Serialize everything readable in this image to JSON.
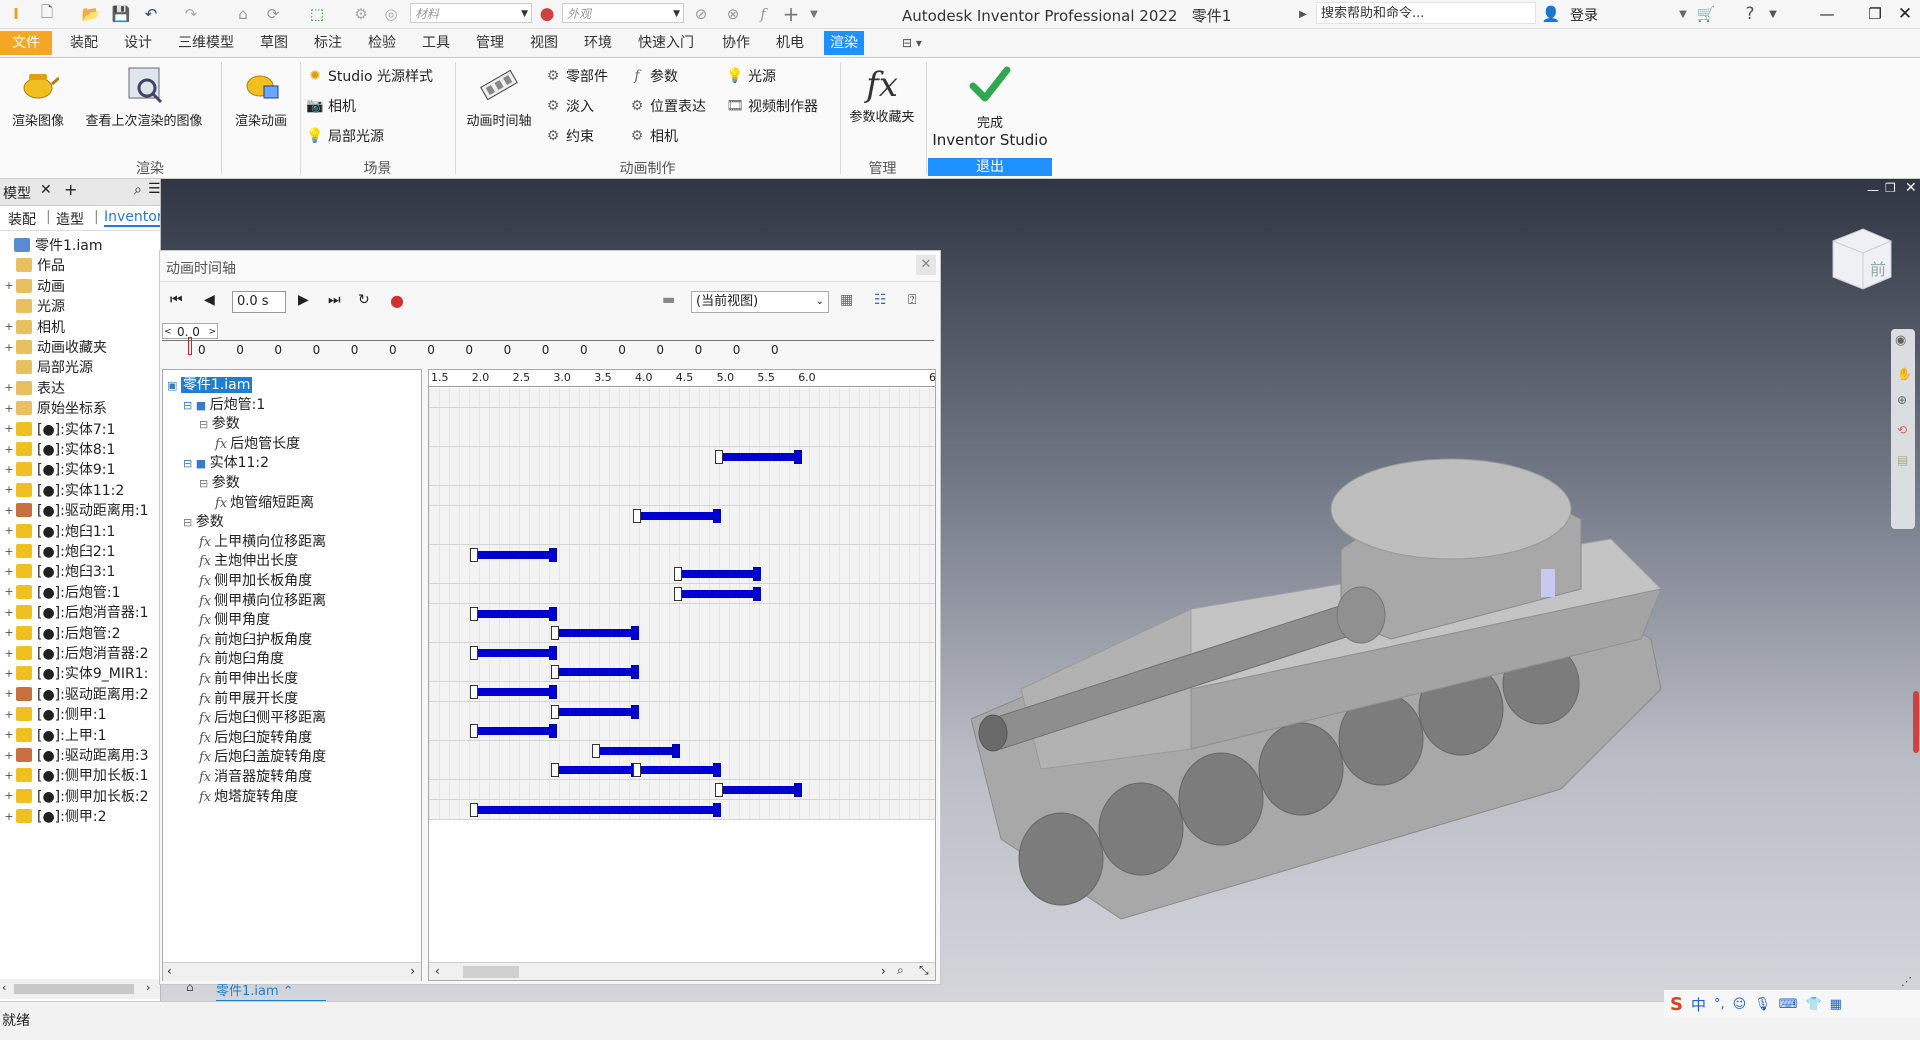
{
  "titlebar": {
    "material_placeholder": "材料",
    "appearance_placeholder": "外观",
    "app_title": "Autodesk Inventor Professional 2022",
    "doc_title": "零件1",
    "search_placeholder": "搜索帮助和命令...",
    "login": "登录"
  },
  "menu": {
    "tabs": [
      "文件",
      "装配",
      "设计",
      "三维模型",
      "草图",
      "标注",
      "检验",
      "工具",
      "管理",
      "视图",
      "环境",
      "快速入门",
      "协作",
      "机电",
      "渲染"
    ],
    "active": "渲染"
  },
  "ribbon": {
    "render": {
      "btn1": "渲染图像",
      "btn2": "查看上次渲染的图像",
      "btn3": "渲染动画",
      "label": "渲染"
    },
    "scene": {
      "studio": "Studio 光源样式",
      "camera": "相机",
      "local_light": "局部光源",
      "label": "场景"
    },
    "animation": {
      "timeline": "动画时间轴",
      "component": "零部件",
      "fade": "淡入",
      "constraint": "约束",
      "param": "参数",
      "position": "位置表达",
      "camera": "相机",
      "light": "光源",
      "video": "视频制作器",
      "label": "动画制作"
    },
    "manage": {
      "fav": "参数收藏夹",
      "label": "管理"
    },
    "exit": {
      "finish": "完成",
      "studio": "Inventor Studio",
      "label": "退出"
    }
  },
  "left_panel": {
    "tab": "模型",
    "subtabs": [
      "装配",
      "造型",
      "Inventor S"
    ],
    "tree": [
      {
        "label": "零件1.iam",
        "exp": ""
      },
      {
        "label": "作品",
        "exp": ""
      },
      {
        "label": "动画",
        "exp": "+"
      },
      {
        "label": "光源",
        "exp": ""
      },
      {
        "label": "相机",
        "exp": "+"
      },
      {
        "label": "动画收藏夹",
        "exp": "+"
      },
      {
        "label": "局部光源",
        "exp": ""
      },
      {
        "label": "表达",
        "exp": "+"
      },
      {
        "label": "原始坐标系",
        "exp": "+"
      },
      {
        "label": "[●]:实体7:1",
        "exp": "+"
      },
      {
        "label": "[●]:实体8:1",
        "exp": "+"
      },
      {
        "label": "[●]:实体9:1",
        "exp": "+"
      },
      {
        "label": "[●]:实体11:2",
        "exp": "+"
      },
      {
        "label": "[●]:驱动距离用:1",
        "exp": "+"
      },
      {
        "label": "[●]:炮臼1:1",
        "exp": "+"
      },
      {
        "label": "[●]:炮臼2:1",
        "exp": "+"
      },
      {
        "label": "[●]:炮臼3:1",
        "exp": "+"
      },
      {
        "label": "[●]:后炮管:1",
        "exp": "+"
      },
      {
        "label": "[●]:后炮消音器:1",
        "exp": "+"
      },
      {
        "label": "[●]:后炮管:2",
        "exp": "+"
      },
      {
        "label": "[●]:后炮消音器:2",
        "exp": "+"
      },
      {
        "label": "[●]:实体9_MIR1:",
        "exp": "+"
      },
      {
        "label": "[●]:驱动距离用:2",
        "exp": "+"
      },
      {
        "label": "[●]:侧甲:1",
        "exp": "+"
      },
      {
        "label": "[●]:上甲:1",
        "exp": "+"
      },
      {
        "label": "[●]:驱动距离用:3",
        "exp": "+"
      },
      {
        "label": "[●]:侧甲加长板:1",
        "exp": "+"
      },
      {
        "label": "[●]:侧甲加长板:2",
        "exp": "+"
      },
      {
        "label": "[●]:侧甲:2",
        "exp": "+"
      }
    ]
  },
  "dialog": {
    "title": "动画时间轴",
    "time_value": "0.0 s",
    "view_select": "(当前视图)",
    "ruler_value": "0. 0",
    "ruler_ticks": [
      "0",
      "0",
      "0",
      "0",
      "0",
      "0",
      "0",
      "0",
      "0",
      "0",
      "0",
      "0",
      "0",
      "0",
      "0",
      "0"
    ],
    "grid_ticks": [
      "1.5",
      "2.0",
      "2.5",
      "3.0",
      "3.5",
      "4.0",
      "4.5",
      "5.0",
      "5.5",
      "6.0",
      "6"
    ],
    "tree": [
      {
        "label": "零件1.iam",
        "level": 0,
        "kind": "asm"
      },
      {
        "label": "后炮管:1",
        "level": 1,
        "kind": "part"
      },
      {
        "label": "参数",
        "level": 2,
        "kind": "param"
      },
      {
        "label": "后炮管长度",
        "level": 3,
        "kind": "fx"
      },
      {
        "label": "实体11:2",
        "level": 1,
        "kind": "part"
      },
      {
        "label": "参数",
        "level": 2,
        "kind": "param"
      },
      {
        "label": "炮管缩短距离",
        "level": 3,
        "kind": "fx"
      },
      {
        "label": "参数",
        "level": 1,
        "kind": "param"
      },
      {
        "label": "上甲横向位移距离",
        "level": 2,
        "kind": "fx"
      },
      {
        "label": "主炮伸出长度",
        "level": 2,
        "kind": "fx"
      },
      {
        "label": "侧甲加长板角度",
        "level": 2,
        "kind": "fx"
      },
      {
        "label": "侧甲横向位移距离",
        "level": 2,
        "kind": "fx"
      },
      {
        "label": "侧甲角度",
        "level": 2,
        "kind": "fx"
      },
      {
        "label": "前炮臼护板角度",
        "level": 2,
        "kind": "fx"
      },
      {
        "label": "前炮臼角度",
        "level": 2,
        "kind": "fx"
      },
      {
        "label": "前甲伸出长度",
        "level": 2,
        "kind": "fx"
      },
      {
        "label": "前甲展开长度",
        "level": 2,
        "kind": "fx"
      },
      {
        "label": "后炮臼侧平移距离",
        "level": 2,
        "kind": "fx"
      },
      {
        "label": "后炮臼旋转角度",
        "level": 2,
        "kind": "fx"
      },
      {
        "label": "后炮臼盖旋转角度",
        "level": 2,
        "kind": "fx"
      },
      {
        "label": "消音器旋转角度",
        "level": 2,
        "kind": "fx"
      },
      {
        "label": "炮塔旋转角度",
        "level": 2,
        "kind": "fx"
      }
    ],
    "bars": [
      null,
      null,
      null,
      [
        [
          5.0,
          6.0
        ]
      ],
      null,
      null,
      [
        [
          4.0,
          5.0
        ]
      ],
      null,
      [
        [
          2.0,
          3.0
        ]
      ],
      [
        [
          4.5,
          5.5
        ]
      ],
      [
        [
          4.5,
          5.5
        ]
      ],
      [
        [
          2.0,
          3.0
        ]
      ],
      [
        [
          3.0,
          4.0
        ]
      ],
      [
        [
          2.0,
          3.0
        ]
      ],
      [
        [
          3.0,
          4.0
        ]
      ],
      [
        [
          2.0,
          3.0
        ]
      ],
      [
        [
          3.0,
          4.0
        ]
      ],
      [
        [
          2.0,
          3.0
        ]
      ],
      [
        [
          3.5,
          4.5
        ]
      ],
      [
        [
          3.0,
          4.0
        ],
        [
          4.0,
          5.0
        ]
      ],
      [
        [
          5.0,
          6.0
        ]
      ],
      [
        [
          2.0,
          5.0
        ]
      ]
    ],
    "bottom_tab": "零件1.iam"
  },
  "status": {
    "text": "就绪",
    "ime": "中"
  },
  "colors": {
    "accent": "#1e90ff",
    "file_tab": "#f5a623",
    "bar": "#0000d0",
    "check": "#2fa84f"
  }
}
